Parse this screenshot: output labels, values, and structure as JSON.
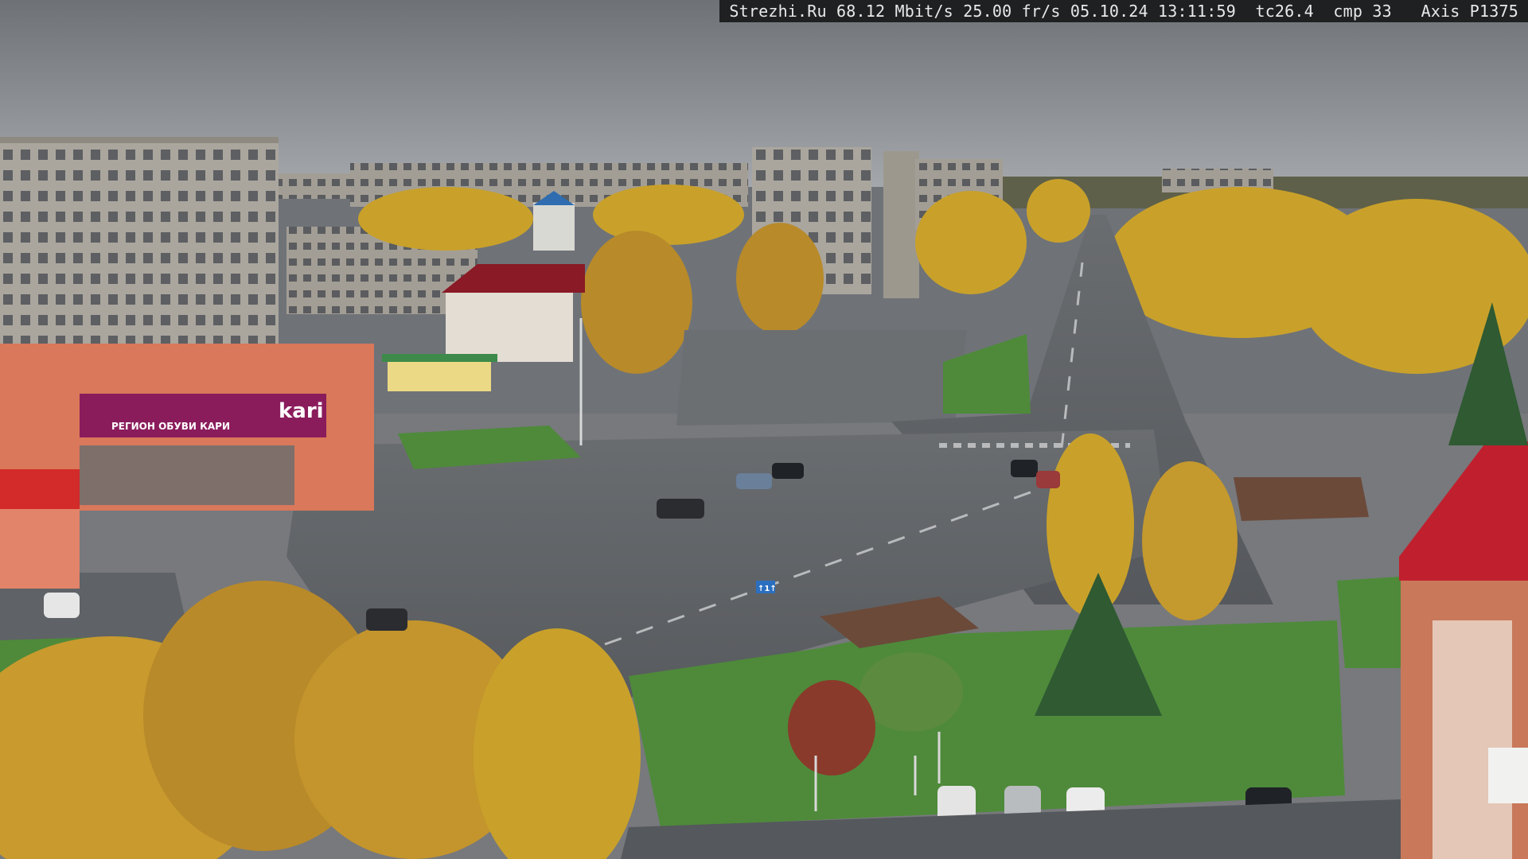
{
  "overlay": {
    "site": "Strezhi.Ru",
    "bitrate": "68.12 Mbit/s",
    "framerate": "25.00 fr/s",
    "datetime": "05.10.24 13:11:59",
    "tc": "tc26.4",
    "cmp": "cmp 33",
    "camera": "Axis P1375"
  },
  "signs": {
    "store_logo": "kari",
    "store_sub": "РЕГИОН ОБУВИ КАРИ",
    "street_sign": "↑1↑"
  },
  "colors": {
    "sky": "#8e9398",
    "road": "#5f6266",
    "autumn_tree": "#c9a12a",
    "grass": "#4e8a3a",
    "building_panel": "#a8a49c",
    "store_facade": "#d9785a",
    "store_banner": "#8a1c5c",
    "red_roof": "#c0202e"
  }
}
